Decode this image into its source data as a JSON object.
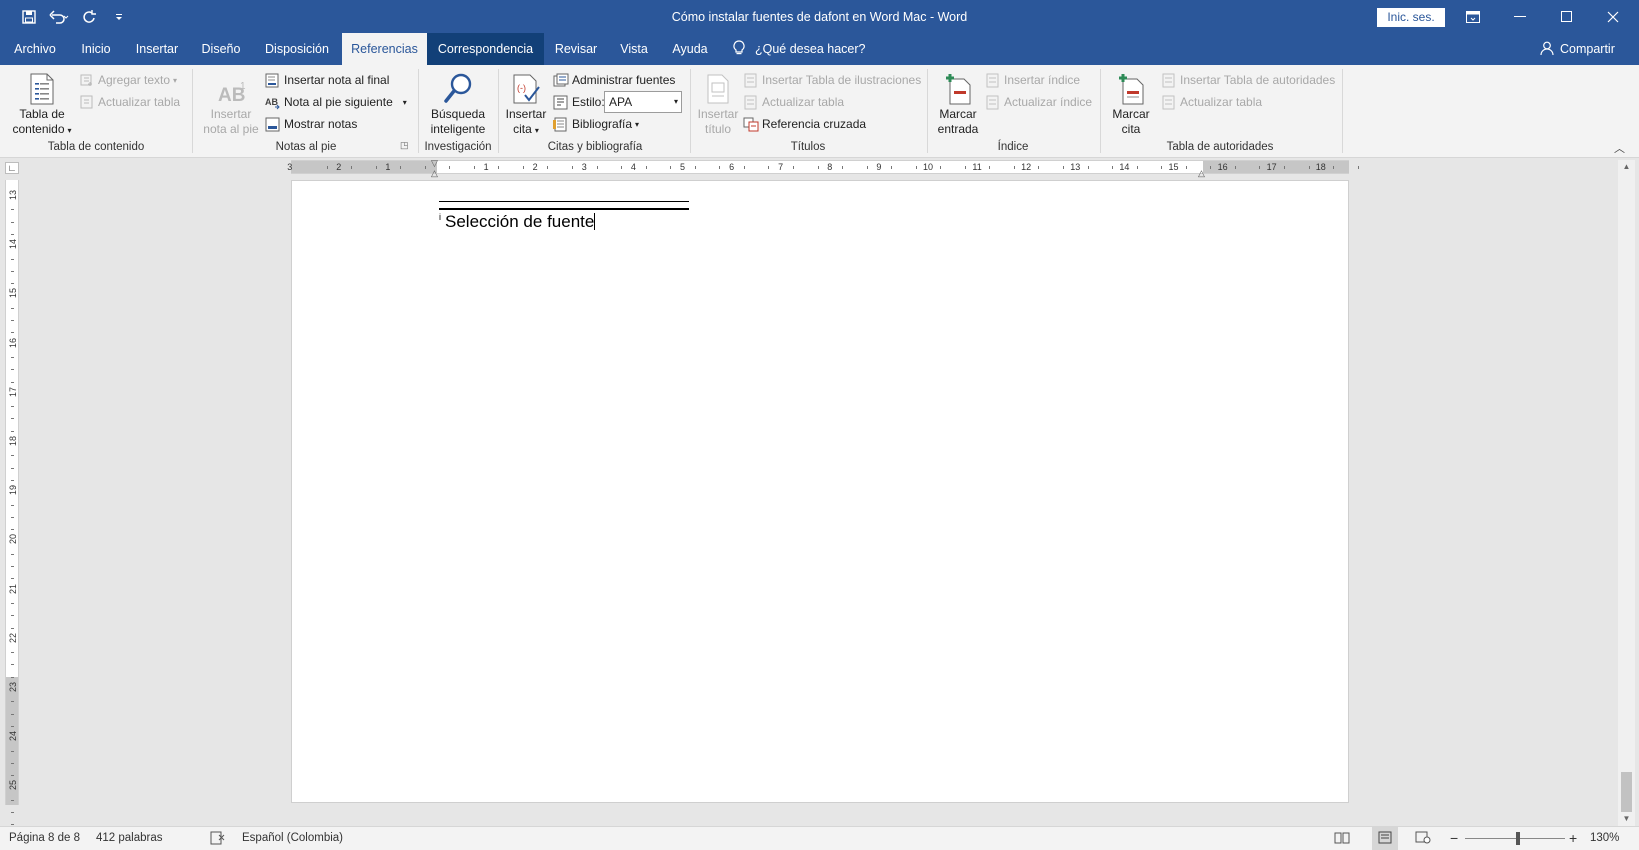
{
  "window": {
    "title": "Cómo instalar fuentes de dafont en Word Mac  -  Word",
    "signin": "Inic. ses."
  },
  "tabs": [
    {
      "label": "Archivo"
    },
    {
      "label": "Inicio"
    },
    {
      "label": "Insertar"
    },
    {
      "label": "Diseño"
    },
    {
      "label": "Disposición"
    },
    {
      "label": "Referencias"
    },
    {
      "label": "Correspondencia"
    },
    {
      "label": "Revisar"
    },
    {
      "label": "Vista"
    },
    {
      "label": "Ayuda"
    }
  ],
  "tellme": "¿Qué desea hacer?",
  "share": "Compartir",
  "ribbon": {
    "toc": {
      "big_line1": "Tabla de",
      "big_line2": "contenido",
      "agregar": "Agregar texto",
      "actualizar": "Actualizar tabla",
      "label": "Tabla de contenido"
    },
    "notas": {
      "insertar_line1": "Insertar",
      "insertar_line2": "nota al pie",
      "nota_final": "Insertar nota al final",
      "siguiente": "Nota al pie siguiente",
      "mostrar": "Mostrar notas",
      "label": "Notas al pie"
    },
    "investigacion": {
      "busqueda_line1": "Búsqueda",
      "busqueda_line2": "inteligente",
      "label": "Investigación"
    },
    "citas": {
      "insertar_line1": "Insertar",
      "insertar_line2": "cita",
      "administrar": "Administrar fuentes",
      "estilo_label": "Estilo:",
      "estilo_value": "APA",
      "bibliografia": "Bibliografía",
      "label": "Citas y bibliografía"
    },
    "titulos": {
      "insertar_line1": "Insertar",
      "insertar_line2": "título",
      "ilustraciones": "Insertar Tabla de ilustraciones",
      "actualizar": "Actualizar tabla",
      "referencia": "Referencia cruzada",
      "label": "Títulos"
    },
    "indice": {
      "marcar_line1": "Marcar",
      "marcar_line2": "entrada",
      "insertar": "Insertar índice",
      "actualizar": "Actualizar índice",
      "label": "Índice"
    },
    "autoridades": {
      "marcar_line1": "Marcar",
      "marcar_line2": "cita",
      "insertar": "Insertar Tabla de autoridades",
      "actualizar": "Actualizar tabla",
      "label": "Tabla de autoridades"
    }
  },
  "ruler": {
    "h_numbers": [
      "3",
      "2",
      "1",
      "1",
      "2",
      "3",
      "4",
      "5",
      "6",
      "7",
      "8",
      "9",
      "10",
      "11",
      "12",
      "13",
      "14",
      "15",
      "16",
      "17",
      "18"
    ],
    "v_numbers": [
      "13",
      "14",
      "15",
      "16",
      "17",
      "18",
      "19",
      "20",
      "21",
      "22",
      "23",
      "24",
      "25"
    ]
  },
  "document": {
    "footnote_mark": "i",
    "footnote_text": "Selección de fuente"
  },
  "status": {
    "page": "Página 8 de 8",
    "words": "412 palabras",
    "language": "Español (Colombia)",
    "zoom": "130%"
  },
  "colors": {
    "accent": "#2b579a",
    "ribbon_bg": "#f3f3f3",
    "workspace": "#e6e6e6"
  }
}
